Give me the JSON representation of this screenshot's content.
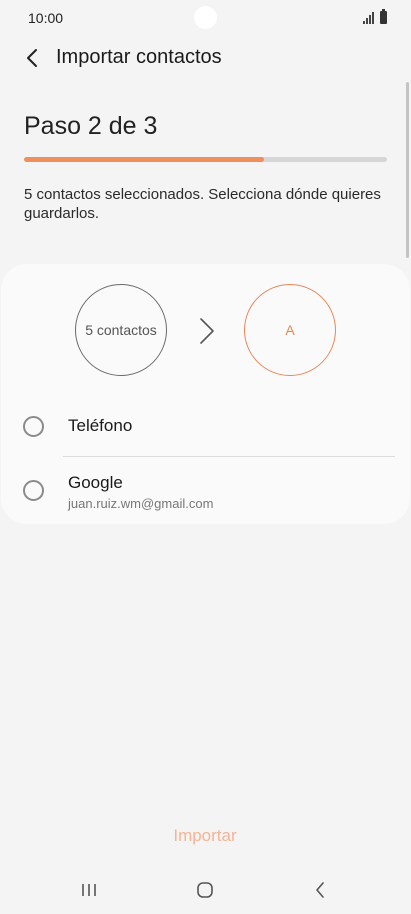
{
  "status_bar": {
    "time": "10:00",
    "icons": [
      "signal-icon",
      "battery-icon"
    ]
  },
  "app_bar": {
    "back_icon": "chevron-left-icon",
    "title": "Importar contactos"
  },
  "step": {
    "title": "Paso 2 de 3",
    "progress_percent": 66
  },
  "description": "5 contactos seleccionados. Selecciona dónde quieres guardarlos.",
  "transfer": {
    "source_label": "5 contactos",
    "target_label": "A",
    "arrow_icon": "chevron-right-icon"
  },
  "options": [
    {
      "label": "Teléfono",
      "sublabel": ""
    },
    {
      "label": "Google",
      "sublabel": "juan.ruiz.wm@gmail.com"
    }
  ],
  "actions": {
    "import_label": "Importar"
  },
  "nav_bar": {
    "icons": [
      "recents-icon",
      "home-icon",
      "back-icon"
    ]
  },
  "colors": {
    "accent": "#f08e5e",
    "accent_disabled": "#f3b498",
    "background": "#f4f4f4",
    "card": "#fafafa"
  }
}
